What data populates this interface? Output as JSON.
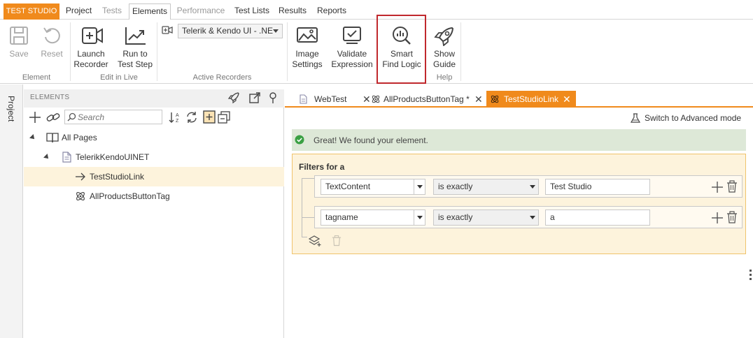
{
  "app": {
    "name": "TEST STUDIO"
  },
  "menu": {
    "items": [
      {
        "label": "Project",
        "state": "normal"
      },
      {
        "label": "Tests",
        "state": "disabled"
      },
      {
        "label": "Elements",
        "state": "active"
      },
      {
        "label": "Performance",
        "state": "disabled"
      },
      {
        "label": "Test Lists",
        "state": "normal"
      },
      {
        "label": "Results",
        "state": "normal"
      },
      {
        "label": "Reports",
        "state": "normal"
      }
    ]
  },
  "ribbon": {
    "save": "Save",
    "reset": "Reset",
    "group_element": "Element",
    "launch_recorder": [
      "Launch",
      "Recorder"
    ],
    "run_to_test_step": [
      "Run to",
      "Test Step"
    ],
    "group_edit_in_live": "Edit in Live",
    "recorder_value": "Telerik & Kendo UI - .NE",
    "group_active_recorders": "Active Recorders",
    "image_settings": [
      "Image",
      "Settings"
    ],
    "validate_expression": [
      "Validate",
      "Expression"
    ],
    "smart_find_logic": [
      "Smart",
      "Find Logic"
    ],
    "show_guide": [
      "Show",
      "Guide"
    ],
    "group_help": "Help"
  },
  "sidebar": {
    "project_tab": "Project"
  },
  "elements_panel": {
    "title": "ELEMENTS",
    "search_placeholder": "Search",
    "tree": [
      {
        "label": "All Pages",
        "icon": "book-icon",
        "level": 0,
        "expanded": true
      },
      {
        "label": "TelerikKendoUINET",
        "icon": "page-icon",
        "level": 1,
        "expanded": true
      },
      {
        "label": "TestStudioLink",
        "icon": "arrow-right-icon",
        "level": 2,
        "selected": true
      },
      {
        "label": "AllProductsButtonTag",
        "icon": "atom-icon",
        "level": 2
      }
    ]
  },
  "doc_tabs": [
    {
      "label": "WebTest",
      "icon": "page-icon",
      "active": false
    },
    {
      "label": "AllProductsButtonTag *",
      "icon": "atom-icon",
      "active": false
    },
    {
      "label": "TestStudioLink",
      "icon": "atom-icon",
      "active": true
    }
  ],
  "editor": {
    "advanced_mode": "Switch to Advanced mode",
    "success_message": "Great! We found your element.",
    "filters_title": "Filters for a",
    "filters": [
      {
        "attribute": "TextContent",
        "operator": "is exactly",
        "value": "Test Studio"
      },
      {
        "attribute": "tagname",
        "operator": "is exactly",
        "value": "a"
      }
    ]
  },
  "colors": {
    "accent": "#f08a1c",
    "highlight": "#c0282d",
    "success_bg": "#dde8d7",
    "filters_bg": "#fdf3dc"
  }
}
